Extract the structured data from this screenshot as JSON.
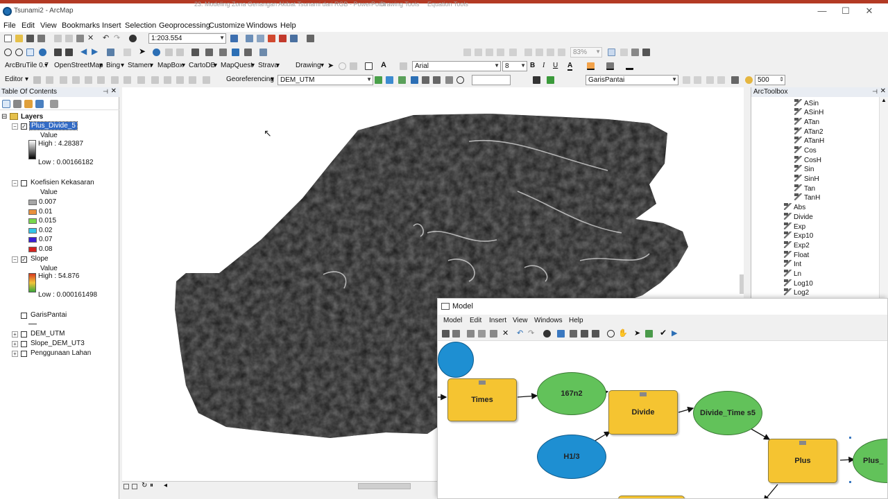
{
  "window": {
    "title": "Tsunami2 - ArcMap",
    "ghost_tabs": [
      "23. Modeling Zona Genangan Akibat Tsunami dari RGB - PowerPoint",
      "Drawing Tools",
      "Equation Tools"
    ]
  },
  "menu": [
    "File",
    "Edit",
    "View",
    "Bookmarks",
    "Insert",
    "Selection",
    "Geoprocessing",
    "Customize",
    "Windows",
    "Help"
  ],
  "toolbar": {
    "scale": "1:203.554",
    "zoom_pct": "83%",
    "arcbrutile": "ArcBruTile 0.7",
    "openstreetmap": "OpenStreetMap",
    "bing": "Bing",
    "stamen": "Stamen",
    "mapbox": "MapBox",
    "cartodb": "CartoDB",
    "mapquest": "MapQuest",
    "strava": "Strava",
    "drawing": "Drawing",
    "font": "Arial",
    "font_size": "8",
    "bold": "B",
    "italic": "I",
    "underline": "U",
    "text_a": "A",
    "editor": "Editor",
    "georeferencing": "Georeferencing",
    "georef_layer": "DEM_UTM",
    "garis_layer": "GarisPantai",
    "buffer_value": "500"
  },
  "toc": {
    "title": "Table Of Contents",
    "layers_label": "Layers",
    "plus_divide": {
      "name": "Plus_Divide_5",
      "value_label": "Value",
      "high": "High : 4.28387",
      "low": "Low : 0.00166182"
    },
    "koef": {
      "name": "Koefisien Kekasaran",
      "value_label": "Value",
      "classes": [
        {
          "label": "0.007",
          "color": "#a6a6a6"
        },
        {
          "label": "0.01",
          "color": "#e8903c"
        },
        {
          "label": "0.015",
          "color": "#78d84c"
        },
        {
          "label": "0.02",
          "color": "#33c6e8"
        },
        {
          "label": "0.07",
          "color": "#3a1fd6"
        },
        {
          "label": "0.08",
          "color": "#d6231f"
        }
      ]
    },
    "slope": {
      "name": "Slope",
      "value_label": "Value",
      "high": "High : 54.876",
      "low": "Low : 0.000161498"
    },
    "garis": "GarisPantai",
    "dem": "DEM_UTM",
    "slope_dem": "Slope_DEM_UT3",
    "penggunaan": "Penggunaan Lahan"
  },
  "arctoolbox": {
    "title": "ArcToolbox",
    "trig_tools": [
      "ASin",
      "ASinH",
      "ATan",
      "ATan2",
      "ATanH",
      "Cos",
      "CosH",
      "Sin",
      "SinH",
      "Tan",
      "TanH"
    ],
    "math_tools": [
      "Abs",
      "Divide",
      "Exp",
      "Exp10",
      "Exp2",
      "Float",
      "Int",
      "Ln",
      "Log10",
      "Log2"
    ]
  },
  "model": {
    "title": "Model",
    "menu": [
      "Model",
      "Edit",
      "Insert",
      "View",
      "Windows",
      "Help"
    ],
    "nodes": {
      "times": "Times",
      "n167": "167n2",
      "divide": "Divide",
      "divide_times": "Divide_Time s5",
      "h13": "H1/3",
      "plus": "Plus",
      "plus_out": "Plus_"
    }
  },
  "colors": {
    "title_accent": "#b33a24",
    "tool_node": "#f5c431",
    "data_node": "#62c25a",
    "input_node": "#1e8fd2"
  }
}
